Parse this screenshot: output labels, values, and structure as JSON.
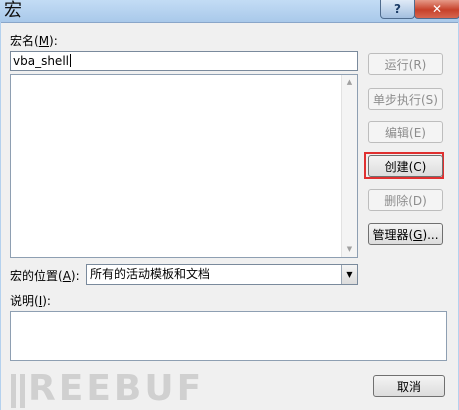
{
  "window": {
    "title": "宏",
    "help_label": "?",
    "close_label": "✕"
  },
  "macro_name": {
    "label_prefix": "宏名(",
    "label_key": "M",
    "label_suffix": "):",
    "value": "vba_shell"
  },
  "buttons": {
    "run": "运行(R)",
    "step": "单步执行(S)",
    "edit": "编辑(E)",
    "create": "创建(C)",
    "delete": "删除(D)",
    "organizer_prefix": "管理器(",
    "organizer_key": "G",
    "organizer_suffix": ")...",
    "cancel": "取消"
  },
  "location": {
    "label_prefix": "宏的位置(",
    "label_key": "A",
    "label_suffix": "):",
    "selected": "所有的活动模板和文档"
  },
  "description": {
    "label_prefix": "说明(",
    "label_key": "I",
    "label_suffix": "):",
    "value": ""
  },
  "watermark": "REEBUF",
  "colors": {
    "highlight": "#e03030",
    "disabled_text": "#8d8d8d"
  }
}
